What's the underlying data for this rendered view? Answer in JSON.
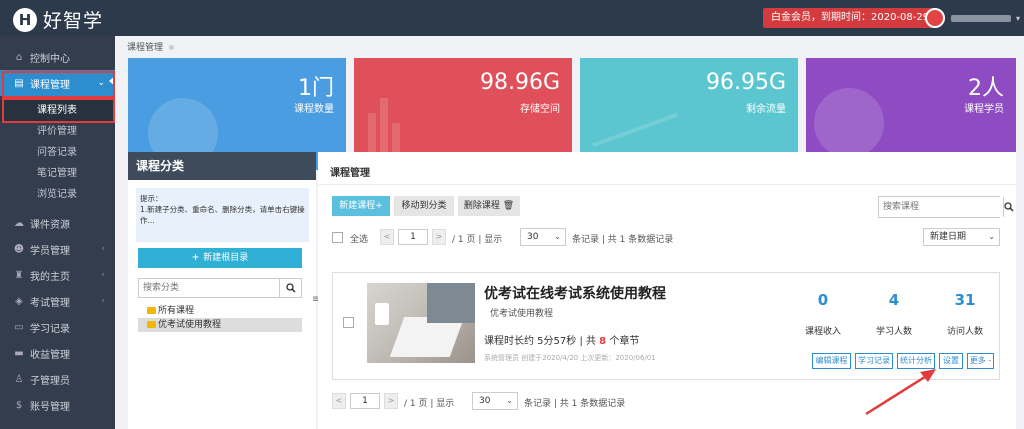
{
  "header": {
    "logo_letter": "H",
    "brand": "好智学",
    "vip_text": "白金会员，到期时间：2020-08-29",
    "user_caret": "▾"
  },
  "sidebar": {
    "items": [
      {
        "icon": "home-icon",
        "glyph": "⌂",
        "label": "控制中心"
      },
      {
        "icon": "book-icon",
        "glyph": "▤",
        "label": "课程管理",
        "arrow": "⌄"
      },
      {
        "icon": "cloud-icon",
        "glyph": "☁",
        "label": "课件资源"
      },
      {
        "icon": "users-icon",
        "glyph": "☻",
        "label": "学员管理",
        "arrow": "‹"
      },
      {
        "icon": "graduation-icon",
        "glyph": "♜",
        "label": "我的主页",
        "arrow": "‹"
      },
      {
        "icon": "tag-icon",
        "glyph": "◈",
        "label": "考试管理",
        "arrow": "‹"
      },
      {
        "icon": "monitor-icon",
        "glyph": "▭",
        "label": "学习记录"
      },
      {
        "icon": "card-icon",
        "glyph": "▬",
        "label": "收益管理"
      },
      {
        "icon": "user-icon",
        "glyph": "♙",
        "label": "子管理员"
      },
      {
        "icon": "dollar-icon",
        "glyph": "$",
        "label": "账号管理"
      }
    ],
    "subitems": [
      "课程列表",
      "评价管理",
      "问答记录",
      "笔记管理",
      "浏览记录"
    ]
  },
  "breadcrumb": "课程管理",
  "stats": [
    {
      "value": "1门",
      "label": "课程数量",
      "color": "#4a9de0"
    },
    {
      "value": "98.96G",
      "label": "存储空间",
      "color": "#e0505a"
    },
    {
      "value": "96.95G",
      "label": "剩余流量",
      "color": "#5bc6cf"
    },
    {
      "value": "2人",
      "label": "课程学员",
      "color": "#8e4bc2"
    }
  ],
  "category": {
    "title": "课程分类",
    "tip": "提示：\n1.新建子分类、重命名、删除分类，请单击右键操作...",
    "new_button": "新建根目录",
    "new_icon": "+",
    "search_placeholder": "搜索分类",
    "tree": [
      "所有课程",
      "优考试使用教程"
    ]
  },
  "course_panel": {
    "title": "课程管理",
    "new_button": "新建课程+",
    "move_button": "移动到分类",
    "delete_button": "删除课程 🗑",
    "search_placeholder": "搜索课程",
    "select_all": "全选",
    "page_value": "1",
    "page_info": "/ 1 页  |  显示",
    "page_size": "30",
    "page_records": "条记录  |  共 1 条数据记录",
    "sort_value": "新建日期",
    "prev": "<",
    "next": ">"
  },
  "course": {
    "name": "优考试在线考试系统使用教程",
    "category": "优考试使用教程",
    "duration_prefix": "课程时长约 5分57秒 | 共 ",
    "chapters": "8",
    "duration_suffix": " 个章节",
    "meta": "系统管理员  创建于2020/4/20 上次更新：2020/06/01",
    "metrics": [
      {
        "value": "0",
        "label": "课程收入"
      },
      {
        "value": "4",
        "label": "学习人数"
      },
      {
        "value": "31",
        "label": "访问人数"
      }
    ],
    "ops": [
      "编辑课程",
      "学习记录",
      "统计分析",
      "设置",
      "更多 -"
    ]
  },
  "bottom_pager": {
    "page_value": "1",
    "page_info": "/ 1 页  |  显示",
    "page_size": "30",
    "page_records": "条记录  |  共 1 条数据记录"
  },
  "colors": {
    "accent": "#2d8ecf",
    "annotation": "#e23b3b"
  }
}
